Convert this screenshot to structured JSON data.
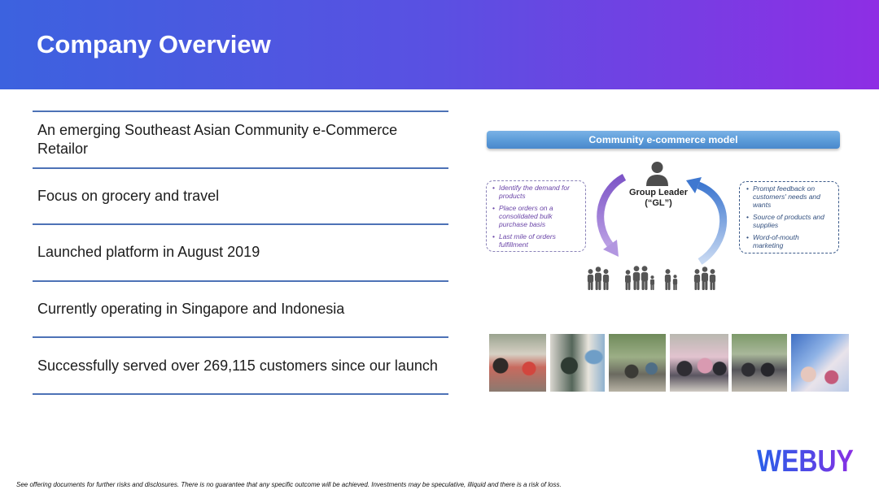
{
  "slide": {
    "title": "Company Overview"
  },
  "overview": {
    "items": [
      "An emerging Southeast Asian Community e-Commerce Retailor",
      "Focus on grocery and travel",
      "Launched platform in August 2019",
      "Currently operating in Singapore and Indonesia",
      "Successfully served over 269,115 customers since our launch"
    ]
  },
  "diagram": {
    "title": "Community e-commerce model",
    "left_box": {
      "bullets": [
        "Identify the demand for products",
        "Place orders on a consolidated bulk purchase basis",
        "Last mile of orders fulfillment"
      ]
    },
    "center": {
      "label": "Group Leader",
      "abbr": "(“GL”)",
      "icon": "person-icon"
    },
    "right_box": {
      "bullets": [
        "Prompt feedback on customers' needs and wants",
        "Source of products and supplies",
        "Word-of-mouth marketing"
      ]
    },
    "community_icon": "people-group-icon",
    "cycle_icons": [
      "purple-cycle-arrow-icon",
      "blue-cycle-arrow-icon"
    ]
  },
  "footer": {
    "logo": "WEBUY",
    "disclaimer": "See offering documents for further risks and disclosures. There is no guarantee that any specific outcome will be achieved. Investments may be speculative, illiquid and there is a risk of loss."
  },
  "colors": {
    "header_start": "#3c62df",
    "header_end": "#8e2ee4",
    "divider": "#4d72b6",
    "diagram_bar": "#5b9bd8",
    "left_box_text": "#6b46a8",
    "left_box_border": "#8a82b8",
    "right_box_text": "#33507f",
    "right_box_border": "#3c5b8a",
    "logo_start": "#2a5fe8",
    "logo_end": "#8b2fe4"
  }
}
